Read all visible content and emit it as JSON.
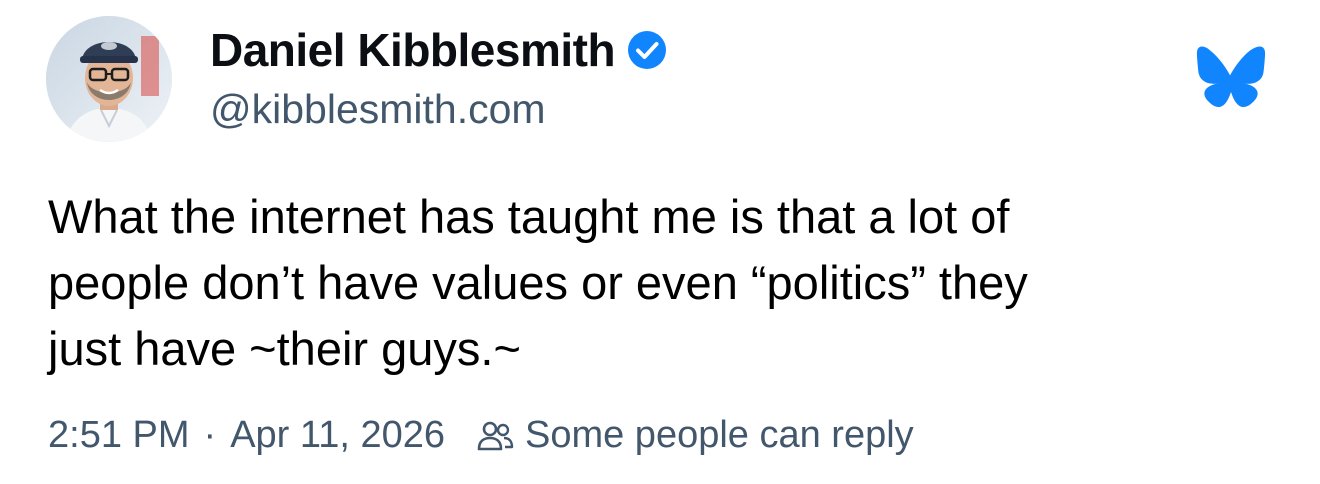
{
  "author": {
    "display_name": "Daniel Kibblesmith",
    "handle": "@kibblesmith.com",
    "verified": true,
    "verified_icon": "verified-check-icon",
    "avatar_icon": "avatar"
  },
  "app": {
    "logo_icon": "bluesky-butterfly-icon",
    "brand_color": "#1185fe"
  },
  "post": {
    "text_lines": [
      "What the internet has taught me is that a lot of",
      "people don’t have values or even “politics” they",
      "just have ~their guys.~"
    ]
  },
  "meta": {
    "time": "2:51 PM",
    "separator": "·",
    "date": "Apr 11, 2026",
    "reply_icon": "people-icon",
    "reply_setting": "Some people can reply"
  },
  "colors": {
    "secondary_text": "#42576c",
    "verified_blue": "#1185fe"
  }
}
